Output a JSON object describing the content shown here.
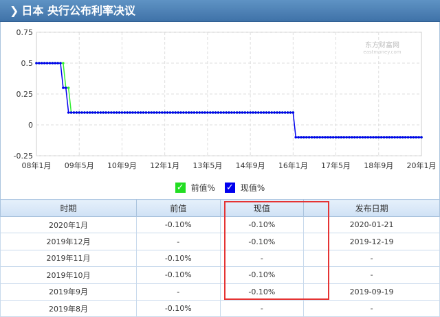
{
  "header": {
    "title": "日本  央行公布利率决议",
    "arrow_icon": "chevron-right-icon"
  },
  "watermark": {
    "brand": "东方财富网",
    "url": "eastmoney.com"
  },
  "chart_data": {
    "type": "line",
    "title": "日本 央行公布利率决议",
    "ylim": [
      -0.25,
      0.75
    ],
    "yticks": [
      "0.75",
      "0.5",
      "0.25",
      "0",
      "-0.25"
    ],
    "ytick_values": [
      0.75,
      0.5,
      0.25,
      0,
      -0.25
    ],
    "xrange": [
      "2008-01",
      "2020-01"
    ],
    "xticks": [
      "08年1月",
      "09年5月",
      "10年9月",
      "12年1月",
      "13年5月",
      "14年9月",
      "16年1月",
      "17年5月",
      "18年9月",
      "20年1月"
    ],
    "grid": true,
    "legend_placement": "bottom",
    "series": [
      {
        "name": "前值%",
        "color": "#33ee33",
        "runs": [
          {
            "from": "2008-01",
            "to": "2008-11",
            "value": 0.5
          },
          {
            "from": "2008-12",
            "to": "2009-01",
            "value": 0.3
          },
          {
            "from": "2009-02",
            "to": "2016-01",
            "value": 0.1
          },
          {
            "from": "2016-03",
            "to": "2020-01",
            "value": -0.1
          }
        ]
      },
      {
        "name": "现值%",
        "color": "#0000ee",
        "runs": [
          {
            "from": "2008-01",
            "to": "2008-10",
            "value": 0.5
          },
          {
            "from": "2008-11",
            "to": "2008-12",
            "value": 0.3
          },
          {
            "from": "2009-01",
            "to": "2016-01",
            "value": 0.1
          },
          {
            "from": "2016-02",
            "to": "2020-01",
            "value": -0.1
          }
        ]
      }
    ]
  },
  "table": {
    "headers": [
      "时期",
      "前值",
      "现值",
      "发布日期"
    ],
    "rows": [
      [
        "2020年1月",
        "-0.10%",
        "-0.10%",
        "2020-01-21"
      ],
      [
        "2019年12月",
        "-",
        "-0.10%",
        "2019-12-19"
      ],
      [
        "2019年11月",
        "-0.10%",
        "-",
        "-"
      ],
      [
        "2019年10月",
        "-0.10%",
        "-0.10%",
        "-"
      ],
      [
        "2019年9月",
        "-",
        "-0.10%",
        "2019-09-19"
      ],
      [
        "2019年8月",
        "-0.10%",
        "-",
        "-"
      ]
    ]
  }
}
